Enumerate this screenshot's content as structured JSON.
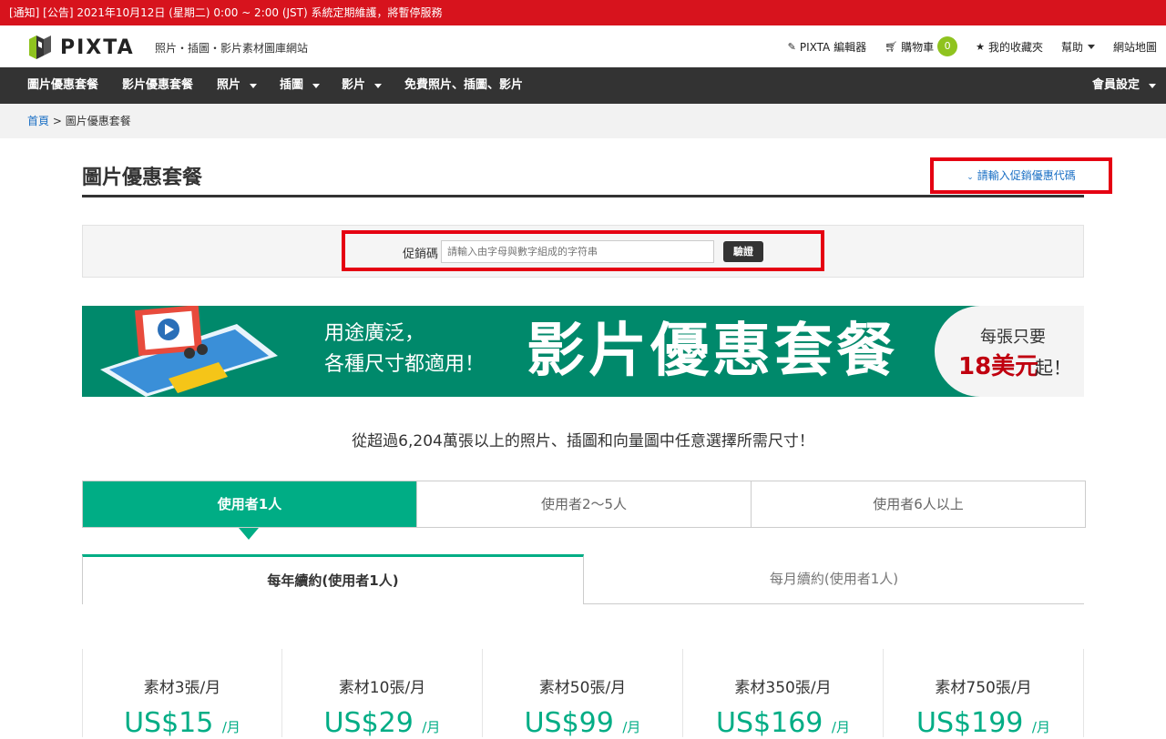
{
  "notice": {
    "text": "[通知] [公告] 2021年10月12日 (星期二) 0:00 ~ 2:00 (JST) 系統定期維護，將暫停服務"
  },
  "header": {
    "logo_text": "PIXTA",
    "tagline": "照片・插圖・影片素材圖庫網站",
    "links": {
      "editor": "PIXTA 編輯器",
      "cart": "購物車",
      "cart_count": "0",
      "favorites": "我的收藏夾",
      "help": "幫助",
      "sitemap": "網站地圖"
    }
  },
  "nav": {
    "items": [
      "圖片優惠套餐",
      "影片優惠套餐",
      "照片",
      "插圖",
      "影片",
      "免費照片、插圖、影片"
    ],
    "account": "會員設定"
  },
  "breadcrumb": {
    "home": "首頁",
    "sep": ">",
    "current": "圖片優惠套餐"
  },
  "page": {
    "title": "圖片優惠套餐",
    "promo_link": "請輸入促銷優惠代碼",
    "code_label": "促銷碼",
    "code_placeholder": "請輸入由字母與數字組成的字符串",
    "code_button": "驗證"
  },
  "banner": {
    "sub_line1": "用途廣泛，",
    "sub_line2": "各種尺寸都適用！",
    "main": "影片優惠套餐",
    "price_line1": "每張只要",
    "price_value": "18美元",
    "price_suffix": "起！"
  },
  "lead": "從超過6,204萬張以上的照片、插圖和向量圖中任意選擇所需尺寸！",
  "user_tabs": [
    "使用者1人",
    "使用者2～5人",
    "使用者6人以上"
  ],
  "billing_tabs": [
    "每年續約(使用者1人)",
    "每月續約(使用者1人)"
  ],
  "plans": [
    {
      "name": "素材3張/月",
      "price": "US$15",
      "per": "/月"
    },
    {
      "name": "素材10張/月",
      "price": "US$29",
      "per": "/月"
    },
    {
      "name": "素材50張/月",
      "price": "US$99",
      "per": "/月"
    },
    {
      "name": "素材350張/月",
      "price": "US$169",
      "per": "/月"
    },
    {
      "name": "素材750張/月",
      "price": "US$199",
      "per": "/月"
    }
  ],
  "colors": {
    "notice": "#d7131d",
    "nav": "#333333",
    "accent": "#00ad85",
    "highlight": "#e50012",
    "link": "#1a6fc4"
  }
}
